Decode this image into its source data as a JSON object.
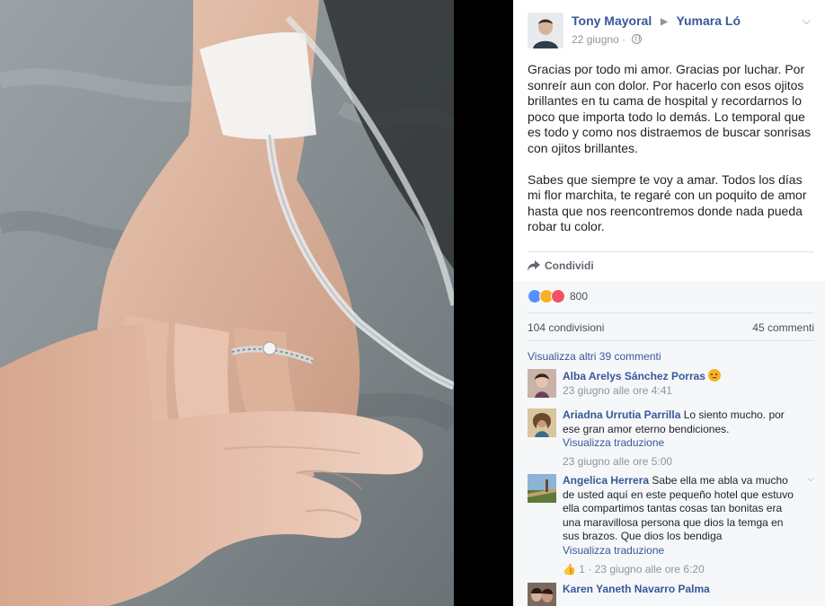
{
  "post": {
    "author": "Tony Mayoral",
    "recipient": "Yumara Ló",
    "date": "22 giugno",
    "paragraph1": "Gracias por todo mi amor. Gracias por luchar. Por sonreír aun con dolor. Por hacerlo con esos ojitos brillantes en tu cama de hospital y recordarnos lo poco que importa todo lo demás. Lo temporal que es todo y como nos distraemos de buscar sonrisas con ojitos brillantes.",
    "paragraph2": "Sabes que siempre te voy a amar. Todos los días mi flor marchita, te regaré con un poquito de amor hasta que nos reencontremos donde nada pueda robar tu color.",
    "share_label": "Condividi"
  },
  "feedback": {
    "reaction_count": "800",
    "shares": "104 condivisioni",
    "comments": "45 commenti",
    "more_comments": "Visualizza altri 39 commenti"
  },
  "comments": [
    {
      "name": "Alba Arelys Sánchez Porras",
      "text": "",
      "translate": "",
      "time": "23 giugno alle ore 4:41",
      "likes": ""
    },
    {
      "name": "Ariadna Urrutia Parrilla",
      "text": "Lo siento mucho. por ese gran amor eterno bendiciones.",
      "translate": "Visualizza traduzione",
      "time": "23 giugno alle ore 5:00",
      "likes": ""
    },
    {
      "name": "Angelica Herrera",
      "text": "Sabe ella me abla va mucho de usted aquí en este pequeño hotel que estuvo ella compartimos tantas cosas tan bonitas era una maravillosa persona que dios la temga en sus brazos. Que dios los bendiga",
      "translate": "Visualizza traduzione",
      "time": "23 giugno alle ore 6:20",
      "likes": "1"
    },
    {
      "name": "Karen Yaneth Navarro Palma",
      "text": "",
      "translate": "",
      "time": "",
      "likes": ""
    }
  ],
  "icons": {
    "globe": "globe-icon",
    "share": "share-arrow-icon",
    "chevron": "chevron-down-icon",
    "reactions": [
      "like-icon",
      "sad-icon",
      "love-icon"
    ]
  },
  "colors": {
    "link": "#365899",
    "meta": "#90949c",
    "like": "#5890ff",
    "love": "#f25268",
    "sad": "#f7b125"
  }
}
